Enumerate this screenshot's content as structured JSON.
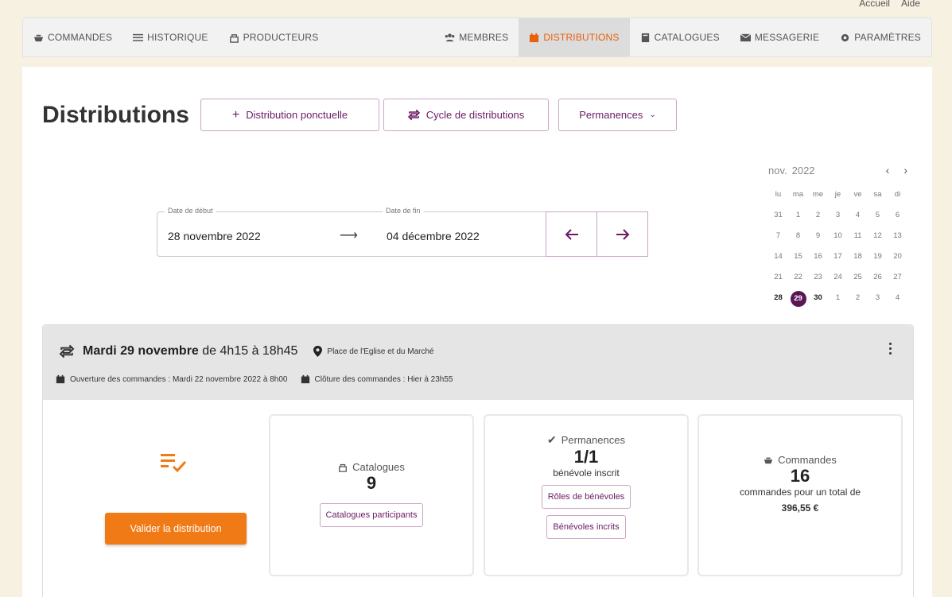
{
  "topbar": {
    "home": "Accueil",
    "help": "Aide"
  },
  "nav": {
    "left": [
      "COMMANDES",
      "HISTORIQUE",
      "PRODUCTEURS"
    ],
    "right": [
      "MEMBRES",
      "DISTRIBUTIONS",
      "CATALOGUES",
      "MESSAGERIE",
      "PARAMÈTRES"
    ],
    "active": "DISTRIBUTIONS",
    "active_color": "#e8600c"
  },
  "page": {
    "title": "Distributions",
    "btn_ponctuelle": "Distribution ponctuelle",
    "btn_cycle": "Cycle de distributions",
    "btn_permanences": "Permanences"
  },
  "daterange": {
    "start_label": "Date de début",
    "start_value": "28 novembre 2022",
    "end_label": "Date de fin",
    "end_value": "04 décembre 2022"
  },
  "calendar": {
    "month": "nov.",
    "year": "2022",
    "weekdays": [
      "lu",
      "ma",
      "me",
      "je",
      "ve",
      "sa",
      "di"
    ],
    "days": [
      "31",
      "1",
      "2",
      "3",
      "4",
      "5",
      "6",
      "7",
      "8",
      "9",
      "10",
      "11",
      "12",
      "13",
      "14",
      "15",
      "16",
      "17",
      "18",
      "19",
      "20",
      "21",
      "22",
      "23",
      "24",
      "25",
      "26",
      "27",
      "28",
      "29",
      "30",
      "1",
      "2",
      "3",
      "4"
    ],
    "selected": "29",
    "selected_color": "#5b1656"
  },
  "distribution": {
    "date": "Mardi 29 novembre",
    "time": "de 4h15 à 18h45",
    "place": "Place de l'Eglise et du Marché",
    "opening": "Ouverture des commandes : Mardi 22 novembre 2022 à 8h00",
    "closing": "Clôture des commandes : Hier à 23h55",
    "validate_btn": "Valider la distribution",
    "catalogues": {
      "label": "Catalogues",
      "count": "9",
      "btn": "Catalogues participants"
    },
    "permanences": {
      "label": "Permanences",
      "count": "1/1",
      "sub": "bénévole inscrit",
      "btn_roles": "Rôles de bénévoles",
      "btn_inscrits": "Bénévoles incrits"
    },
    "commandes": {
      "label": "Commandes",
      "count": "16",
      "sub": "commandes pour un total de",
      "total": "396,55 €"
    }
  }
}
